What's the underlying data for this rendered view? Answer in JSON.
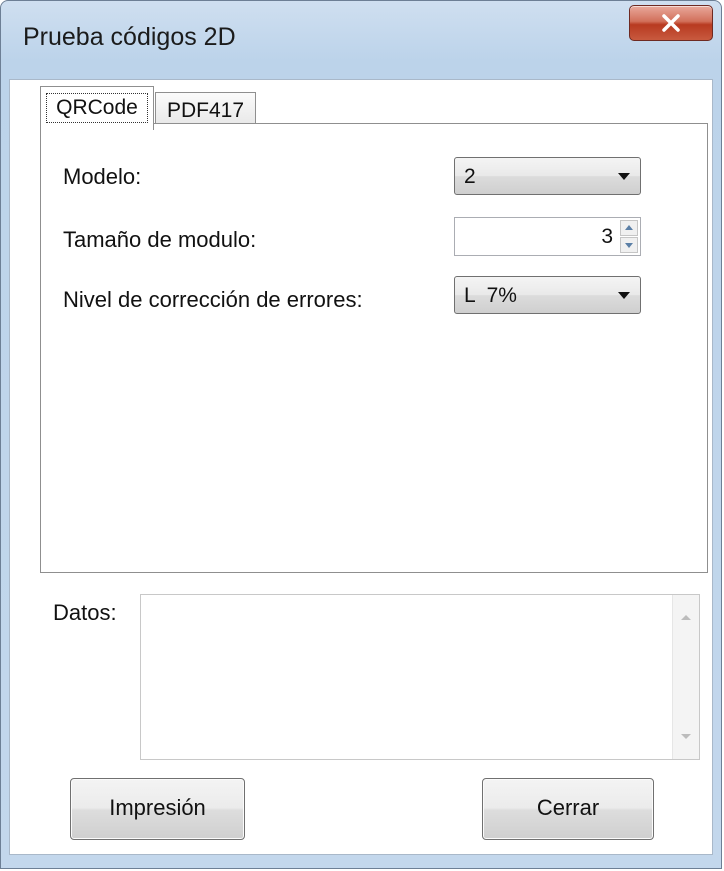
{
  "window": {
    "title": "Prueba códigos 2D",
    "close_icon": "close-x-icon"
  },
  "tabs": [
    {
      "label": "QRCode",
      "active": true
    },
    {
      "label": "PDF417",
      "active": false
    }
  ],
  "qrcode": {
    "model_label": "Modelo:",
    "model_value": "2",
    "module_size_label": "Tamaño de modulo:",
    "module_size_value": "3",
    "error_level_label": "Nivel de corrección de errores:",
    "error_level_value": "L  7%"
  },
  "datos": {
    "label": "Datos:",
    "value": ""
  },
  "buttons": {
    "print_label": "Impresión",
    "close_label": "Cerrar"
  },
  "colors": {
    "close_button": "#c8553c",
    "window_frame": "#bcd3ea"
  }
}
